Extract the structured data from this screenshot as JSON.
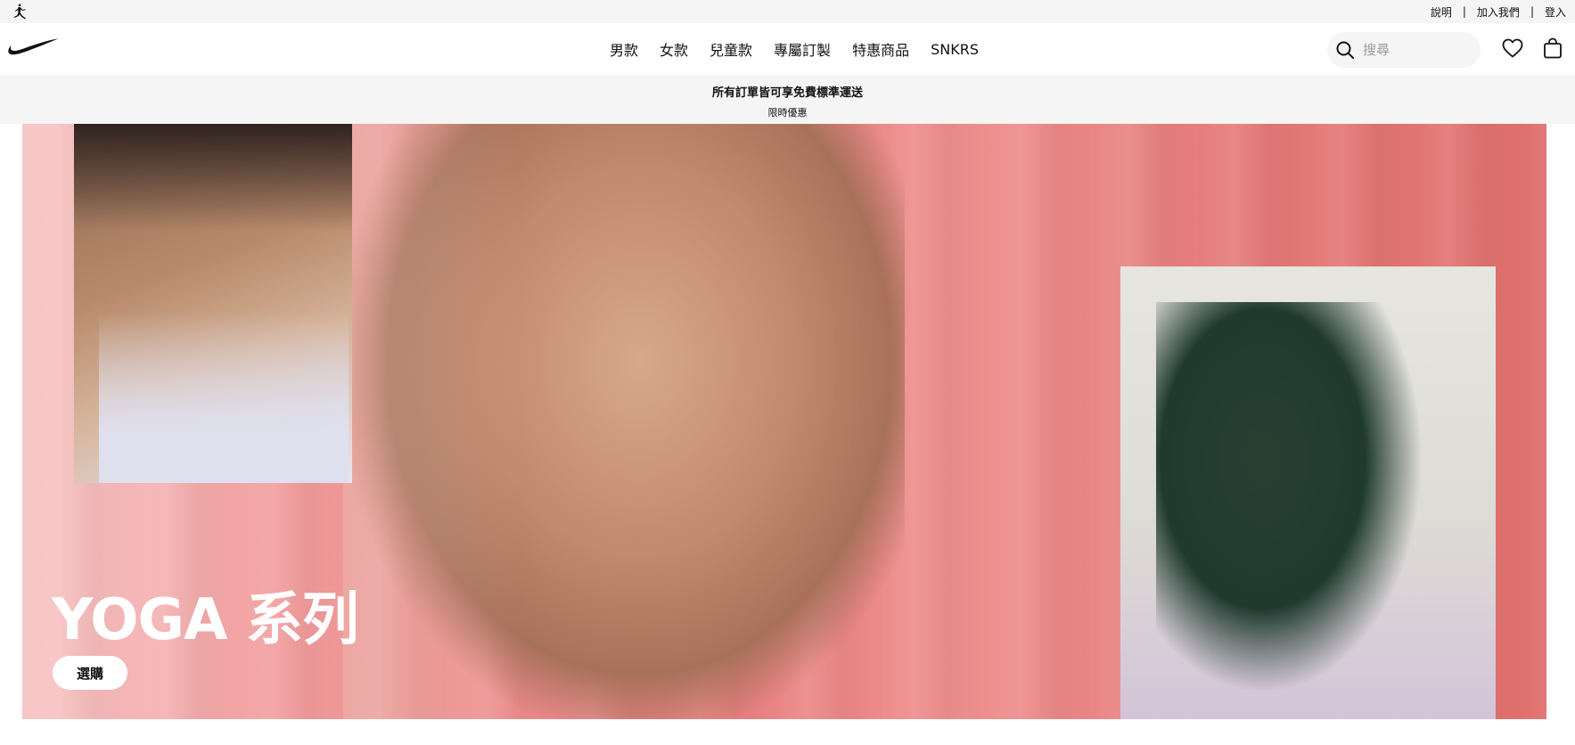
{
  "utility": {
    "jordan_icon": "jordan-jumpman-icon",
    "links": [
      "說明",
      "加入我們",
      "登入"
    ],
    "separator": "|"
  },
  "nav": {
    "logo_icon": "nike-swoosh-icon",
    "menu": [
      "男款",
      "女款",
      "兒童款",
      "專屬訂製",
      "特惠商品",
      "SNKRS"
    ],
    "search_placeholder": "搜尋",
    "search_icon": "search-icon",
    "favorites_icon": "heart-icon",
    "bag_icon": "bag-icon"
  },
  "promo": {
    "title": "所有訂單皆可享免費標準運送",
    "subtitle": "限時優惠"
  },
  "hero": {
    "title": "YOGA 系列",
    "cta": "選購"
  },
  "colors": {
    "utility_bg": "#f5f5f5",
    "hero_coral": "#ee8f8e",
    "text": "#111111"
  }
}
